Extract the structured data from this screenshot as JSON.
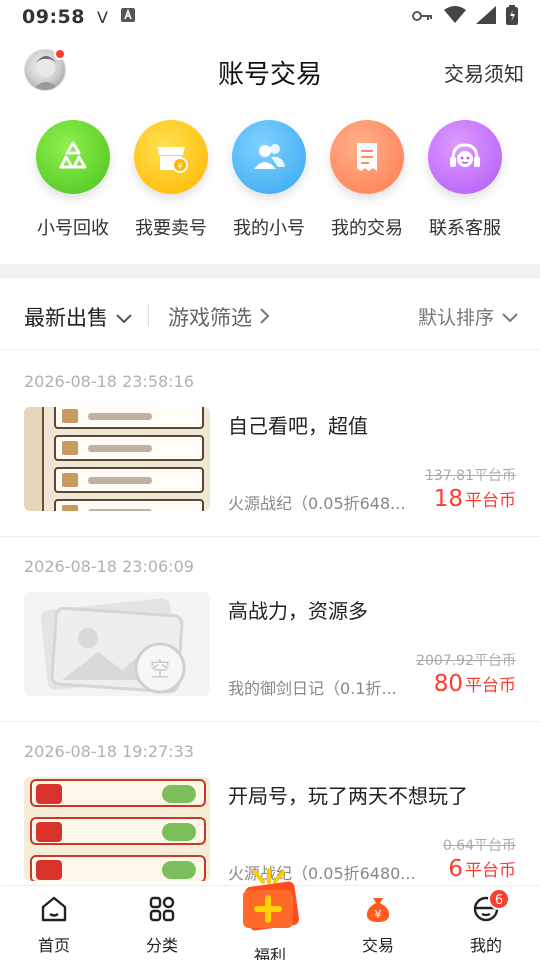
{
  "status_bar": {
    "time": "09:58",
    "icons": [
      "v-icon",
      "a-icon",
      "key-icon",
      "wifi-icon",
      "signal-icon",
      "battery-icon"
    ]
  },
  "header": {
    "title": "账号交易",
    "notice_link": "交易须知"
  },
  "shortcuts": [
    {
      "label": "小号回收",
      "icon": "recycle-icon",
      "color": "#5fd02d"
    },
    {
      "label": "我要卖号",
      "icon": "shop-icon",
      "color": "#ffc21a"
    },
    {
      "label": "我的小号",
      "icon": "users-icon",
      "color": "#4fb7f7"
    },
    {
      "label": "我的交易",
      "icon": "receipt-icon",
      "color": "#ff8a5b"
    },
    {
      "label": "联系客服",
      "icon": "headset-icon",
      "color": "#c36dff"
    }
  ],
  "filter": {
    "latest": "最新出售",
    "game_filter": "游戏筛选",
    "sort": "默认排序"
  },
  "listings": [
    {
      "date": "2026-08-18 23:58:16",
      "title": "自己看吧，超值",
      "game": "火源战纪（0.05折648...",
      "original_price": "137.81平台币",
      "price": "18",
      "unit": "平台币"
    },
    {
      "date": "2026-08-18 23:06:09",
      "title": "高战力，资源多",
      "game": "我的御剑日记（0.1折...",
      "original_price": "2007.92平台币",
      "price": "80",
      "unit": "平台币"
    },
    {
      "date": "2026-08-18 19:27:33",
      "title": "开局号，玩了两天不想玩了",
      "game": "火源战纪（0.05折6480...",
      "original_price": "0.64平台币",
      "price": "6",
      "unit": "平台币"
    }
  ],
  "tab_bar": {
    "home": "首页",
    "category": "分类",
    "welfare": "福利",
    "trade": "交易",
    "mine": "我的",
    "mine_badge": "6"
  },
  "colors": {
    "accent": "#ff3b30",
    "trade_active": "#ff5a1f"
  }
}
